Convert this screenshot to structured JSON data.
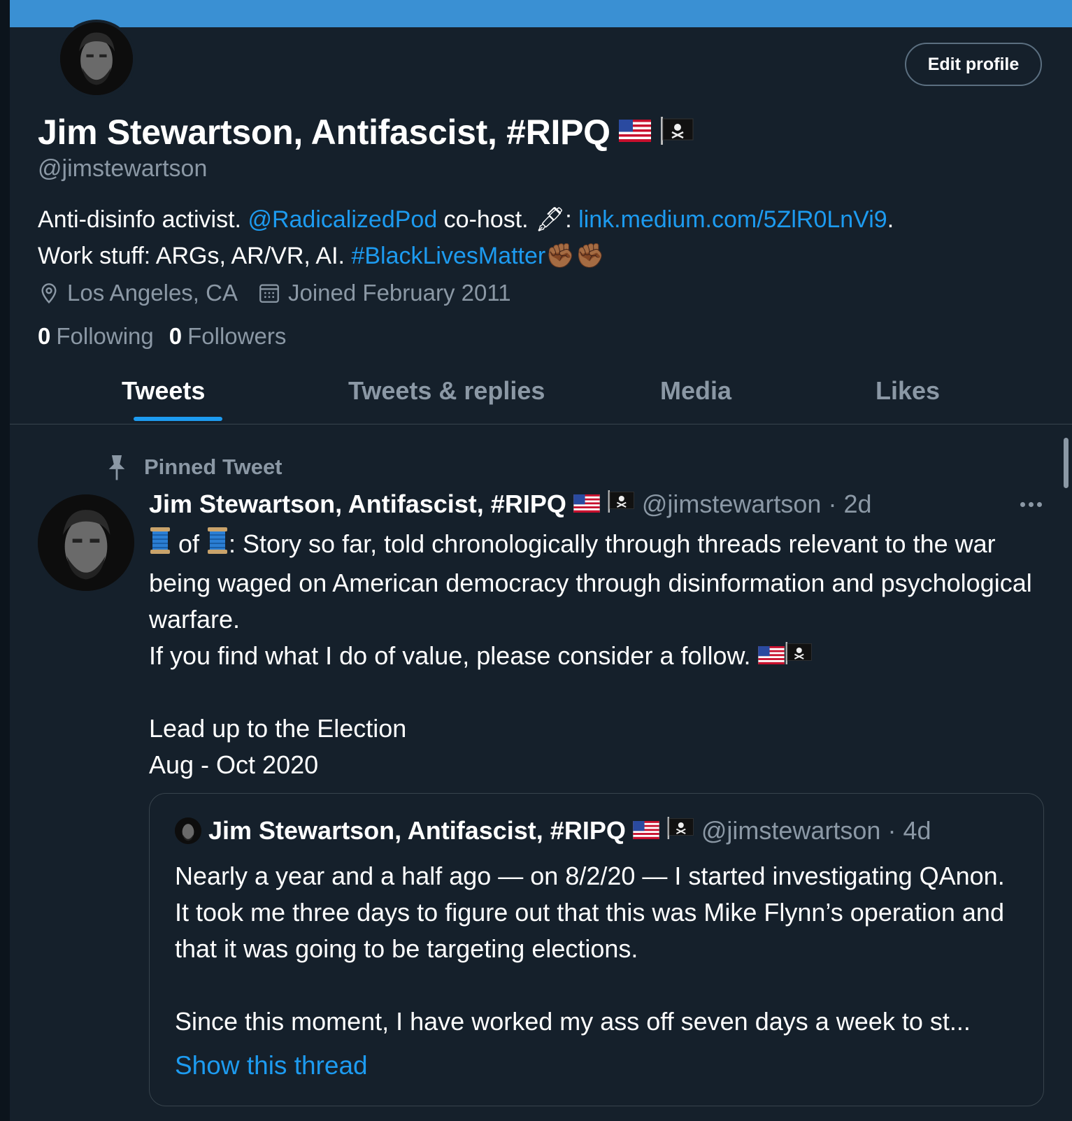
{
  "profile": {
    "display_name": "Jim Stewartson, Antifascist, #RIPQ",
    "handle": "@jimstewartson",
    "edit_button": "Edit profile",
    "bio": {
      "line1_prefix": "Anti-disinfo activist. ",
      "mention": "@RadicalizedPod",
      "line1_mid": " co-host. ",
      "pen_emoji": "🖋",
      "line1_colon": ": ",
      "link": "link.medium.com/5ZlR0LnVi9",
      "line1_end": ".",
      "line2_prefix": "Work stuff: ARGs, AR/VR, AI. ",
      "hashtag": "#BlackLivesMatter",
      "fist_emoji": "✊🏾✊🏾"
    },
    "location": "Los Angeles, CA",
    "joined": "Joined February 2011",
    "following_count": "0",
    "following_label": "Following",
    "followers_count": "0",
    "followers_label": "Followers"
  },
  "tabs": [
    {
      "label": "Tweets",
      "active": true
    },
    {
      "label": "Tweets & replies",
      "active": false
    },
    {
      "label": "Media",
      "active": false
    },
    {
      "label": "Likes",
      "active": false
    }
  ],
  "pinned_tweet": {
    "pinned_label": "Pinned Tweet",
    "author": "Jim Stewartson, Antifascist, #RIPQ",
    "handle": "@jimstewartson",
    "time": "· 2d",
    "body": {
      "line1_of": " of ",
      "line1_rest": ": Story so far, told chronologically through threads relevant to the war being waged on American democracy through disinformation and psychological warfare.",
      "line2": "If you find what I do of value, please consider a follow. ",
      "line3": "Lead up to the Election",
      "line4": "Aug - Oct 2020"
    },
    "quoted": {
      "author": "Jim Stewartson, Antifascist, #RIPQ",
      "handle": "@jimstewartson",
      "time": "· 4d",
      "para1": "Nearly a year and a half ago — on 8/2/20 — I started investigating QAnon. It took me three days to figure out that this was Mike Flynn’s operation and that it was going to be targeting elections.",
      "para2": "Since this moment, I have worked my ass off seven days a week to st...",
      "show_thread": "Show this thread"
    }
  },
  "colors": {
    "background": "#15202b",
    "banner": "#3a90d3",
    "accent": "#1d9bf0",
    "muted_text": "#8b98a5",
    "border": "#38444d"
  },
  "icons": [
    "location-pin-icon",
    "calendar-icon",
    "pin-icon",
    "more-dots-icon",
    "us-flag-icon",
    "pirate-flag-icon",
    "spool-of-thread-icon"
  ]
}
